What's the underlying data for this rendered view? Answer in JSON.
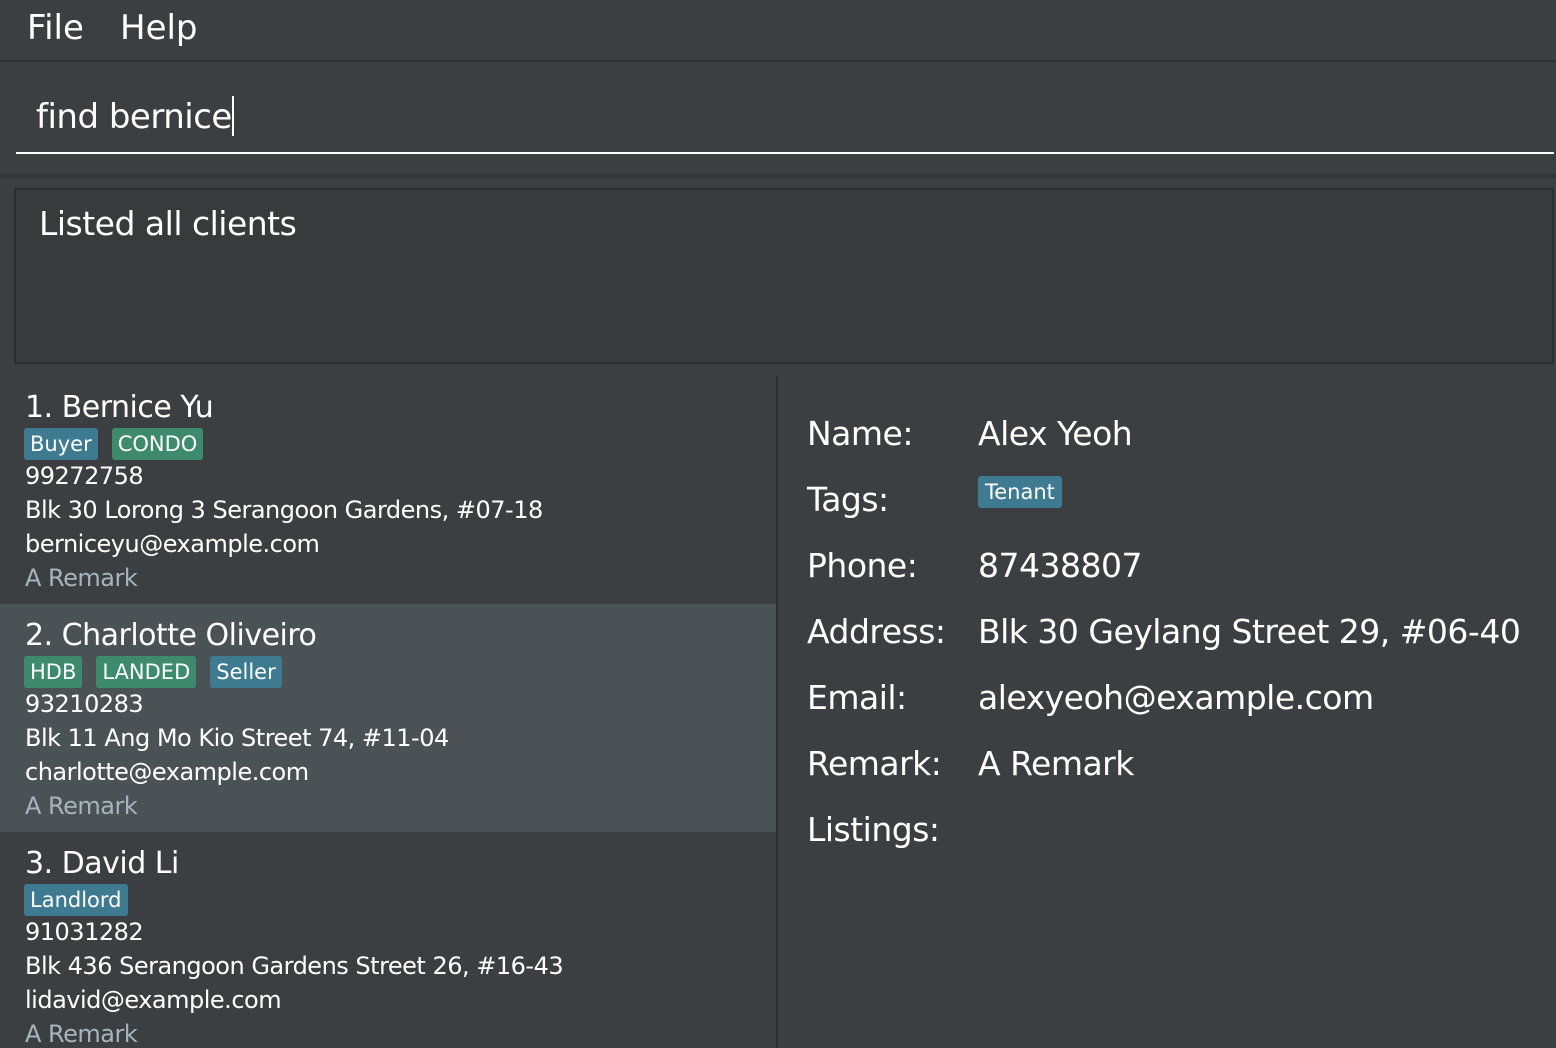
{
  "menu": {
    "file": "File",
    "help": "Help"
  },
  "command": {
    "value": "find bernice"
  },
  "result": {
    "message": "Listed all clients"
  },
  "clients": [
    {
      "name": "1. Bernice Yu",
      "tags": [
        {
          "label": "Buyer"
        },
        {
          "label": "CONDO"
        }
      ],
      "phone": "99272758",
      "address": "Blk 30 Lorong 3 Serangoon Gardens, #07-18",
      "email": "berniceyu@example.com",
      "remark": "A Remark"
    },
    {
      "name": "2. Charlotte Oliveiro",
      "tags": [
        {
          "label": "HDB"
        },
        {
          "label": "LANDED"
        },
        {
          "label": "Seller"
        }
      ],
      "phone": "93210283",
      "address": "Blk 11 Ang Mo Kio Street 74, #11-04",
      "email": "charlotte@example.com",
      "remark": "A Remark"
    },
    {
      "name": "3. David Li",
      "tags": [
        {
          "label": "Landlord"
        }
      ],
      "phone": "91031282",
      "address": "Blk 436 Serangoon Gardens Street 26, #16-43",
      "email": "lidavid@example.com",
      "remark": "A Remark"
    }
  ],
  "detail": {
    "labels": {
      "name": "Name:",
      "tags": "Tags:",
      "phone": "Phone:",
      "address": "Address:",
      "email": "Email:",
      "remark": "Remark:",
      "listings": "Listings:"
    },
    "name": "Alex Yeoh",
    "tag": "Tenant",
    "phone": "87438807",
    "address": "Blk 30 Geylang Street 29, #06-40",
    "email": "alexyeoh@example.com",
    "remark": "A Remark"
  },
  "colors": {
    "background": "#3c3f41",
    "selected_card": "#4b5256",
    "role_tag": "#3e7b91",
    "property_tag": "#3d8a6c",
    "remark_text": "#a8b4bc"
  }
}
